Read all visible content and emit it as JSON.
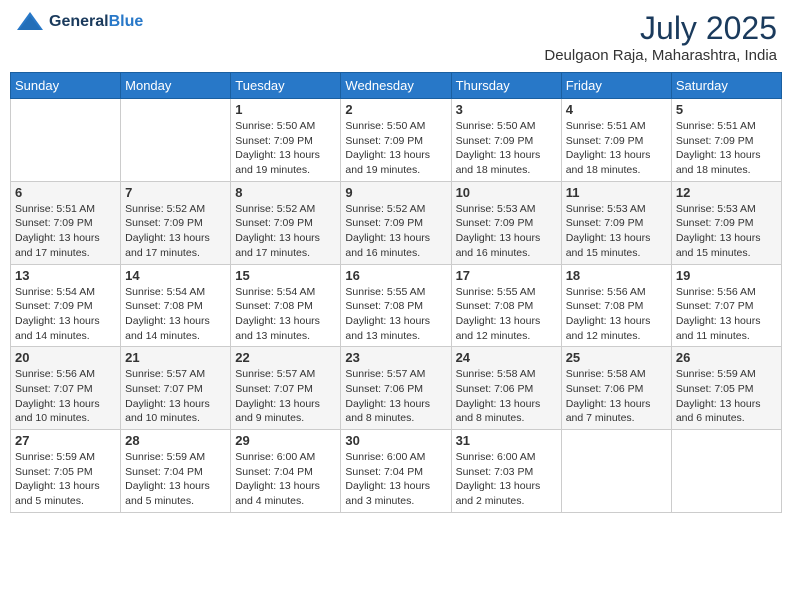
{
  "header": {
    "logo": {
      "general": "General",
      "blue": "Blue"
    },
    "title": "July 2025",
    "location": "Deulgaon Raja, Maharashtra, India"
  },
  "weekdays": [
    "Sunday",
    "Monday",
    "Tuesday",
    "Wednesday",
    "Thursday",
    "Friday",
    "Saturday"
  ],
  "weeks": [
    {
      "altRow": false,
      "days": [
        {
          "num": "",
          "content": ""
        },
        {
          "num": "",
          "content": ""
        },
        {
          "num": "1",
          "content": "Sunrise: 5:50 AM\nSunset: 7:09 PM\nDaylight: 13 hours\nand 19 minutes."
        },
        {
          "num": "2",
          "content": "Sunrise: 5:50 AM\nSunset: 7:09 PM\nDaylight: 13 hours\nand 19 minutes."
        },
        {
          "num": "3",
          "content": "Sunrise: 5:50 AM\nSunset: 7:09 PM\nDaylight: 13 hours\nand 18 minutes."
        },
        {
          "num": "4",
          "content": "Sunrise: 5:51 AM\nSunset: 7:09 PM\nDaylight: 13 hours\nand 18 minutes."
        },
        {
          "num": "5",
          "content": "Sunrise: 5:51 AM\nSunset: 7:09 PM\nDaylight: 13 hours\nand 18 minutes."
        }
      ]
    },
    {
      "altRow": true,
      "days": [
        {
          "num": "6",
          "content": "Sunrise: 5:51 AM\nSunset: 7:09 PM\nDaylight: 13 hours\nand 17 minutes."
        },
        {
          "num": "7",
          "content": "Sunrise: 5:52 AM\nSunset: 7:09 PM\nDaylight: 13 hours\nand 17 minutes."
        },
        {
          "num": "8",
          "content": "Sunrise: 5:52 AM\nSunset: 7:09 PM\nDaylight: 13 hours\nand 17 minutes."
        },
        {
          "num": "9",
          "content": "Sunrise: 5:52 AM\nSunset: 7:09 PM\nDaylight: 13 hours\nand 16 minutes."
        },
        {
          "num": "10",
          "content": "Sunrise: 5:53 AM\nSunset: 7:09 PM\nDaylight: 13 hours\nand 16 minutes."
        },
        {
          "num": "11",
          "content": "Sunrise: 5:53 AM\nSunset: 7:09 PM\nDaylight: 13 hours\nand 15 minutes."
        },
        {
          "num": "12",
          "content": "Sunrise: 5:53 AM\nSunset: 7:09 PM\nDaylight: 13 hours\nand 15 minutes."
        }
      ]
    },
    {
      "altRow": false,
      "days": [
        {
          "num": "13",
          "content": "Sunrise: 5:54 AM\nSunset: 7:09 PM\nDaylight: 13 hours\nand 14 minutes."
        },
        {
          "num": "14",
          "content": "Sunrise: 5:54 AM\nSunset: 7:08 PM\nDaylight: 13 hours\nand 14 minutes."
        },
        {
          "num": "15",
          "content": "Sunrise: 5:54 AM\nSunset: 7:08 PM\nDaylight: 13 hours\nand 13 minutes."
        },
        {
          "num": "16",
          "content": "Sunrise: 5:55 AM\nSunset: 7:08 PM\nDaylight: 13 hours\nand 13 minutes."
        },
        {
          "num": "17",
          "content": "Sunrise: 5:55 AM\nSunset: 7:08 PM\nDaylight: 13 hours\nand 12 minutes."
        },
        {
          "num": "18",
          "content": "Sunrise: 5:56 AM\nSunset: 7:08 PM\nDaylight: 13 hours\nand 12 minutes."
        },
        {
          "num": "19",
          "content": "Sunrise: 5:56 AM\nSunset: 7:07 PM\nDaylight: 13 hours\nand 11 minutes."
        }
      ]
    },
    {
      "altRow": true,
      "days": [
        {
          "num": "20",
          "content": "Sunrise: 5:56 AM\nSunset: 7:07 PM\nDaylight: 13 hours\nand 10 minutes."
        },
        {
          "num": "21",
          "content": "Sunrise: 5:57 AM\nSunset: 7:07 PM\nDaylight: 13 hours\nand 10 minutes."
        },
        {
          "num": "22",
          "content": "Sunrise: 5:57 AM\nSunset: 7:07 PM\nDaylight: 13 hours\nand 9 minutes."
        },
        {
          "num": "23",
          "content": "Sunrise: 5:57 AM\nSunset: 7:06 PM\nDaylight: 13 hours\nand 8 minutes."
        },
        {
          "num": "24",
          "content": "Sunrise: 5:58 AM\nSunset: 7:06 PM\nDaylight: 13 hours\nand 8 minutes."
        },
        {
          "num": "25",
          "content": "Sunrise: 5:58 AM\nSunset: 7:06 PM\nDaylight: 13 hours\nand 7 minutes."
        },
        {
          "num": "26",
          "content": "Sunrise: 5:59 AM\nSunset: 7:05 PM\nDaylight: 13 hours\nand 6 minutes."
        }
      ]
    },
    {
      "altRow": false,
      "days": [
        {
          "num": "27",
          "content": "Sunrise: 5:59 AM\nSunset: 7:05 PM\nDaylight: 13 hours\nand 5 minutes."
        },
        {
          "num": "28",
          "content": "Sunrise: 5:59 AM\nSunset: 7:04 PM\nDaylight: 13 hours\nand 5 minutes."
        },
        {
          "num": "29",
          "content": "Sunrise: 6:00 AM\nSunset: 7:04 PM\nDaylight: 13 hours\nand 4 minutes."
        },
        {
          "num": "30",
          "content": "Sunrise: 6:00 AM\nSunset: 7:04 PM\nDaylight: 13 hours\nand 3 minutes."
        },
        {
          "num": "31",
          "content": "Sunrise: 6:00 AM\nSunset: 7:03 PM\nDaylight: 13 hours\nand 2 minutes."
        },
        {
          "num": "",
          "content": ""
        },
        {
          "num": "",
          "content": ""
        }
      ]
    }
  ]
}
